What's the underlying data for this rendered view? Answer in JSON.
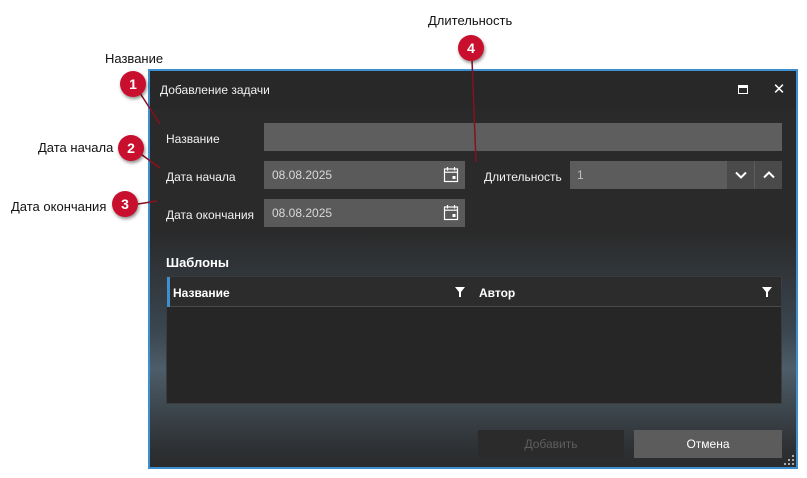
{
  "annotations": [
    {
      "number": "1",
      "label": "Название"
    },
    {
      "number": "2",
      "label": "Дата начала"
    },
    {
      "number": "3",
      "label": "Дата окончания"
    },
    {
      "number": "4",
      "label": "Длительность"
    }
  ],
  "dialog": {
    "title": "Добавление задачи",
    "maximize_icon": "maximize-icon",
    "close_symbol": "✕"
  },
  "form": {
    "name_label": "Название",
    "name_value": "",
    "start_date_label": "Дата начала",
    "start_date_value": "08.08.2025",
    "end_date_label": "Дата окончания",
    "end_date_value": "08.08.2025",
    "duration_label": "Длительность",
    "duration_value": "1",
    "calendar_icon": "calendar-icon",
    "spin_down_icon": "chevron-down-icon",
    "spin_up_icon": "chevron-up-icon"
  },
  "templates": {
    "section_title": "Шаблоны",
    "columns": [
      {
        "label": "Название",
        "filter_icon": "filter-icon"
      },
      {
        "label": "Автор",
        "filter_icon": "filter-icon"
      }
    ],
    "rows": []
  },
  "buttons": {
    "add_label": "Добавить",
    "cancel_label": "Отмена"
  },
  "colors": {
    "marker": "#c8102e",
    "window_border": "#3d8fd0",
    "window_background": "#2a2a2a",
    "input_background": "#5e5e5e"
  }
}
